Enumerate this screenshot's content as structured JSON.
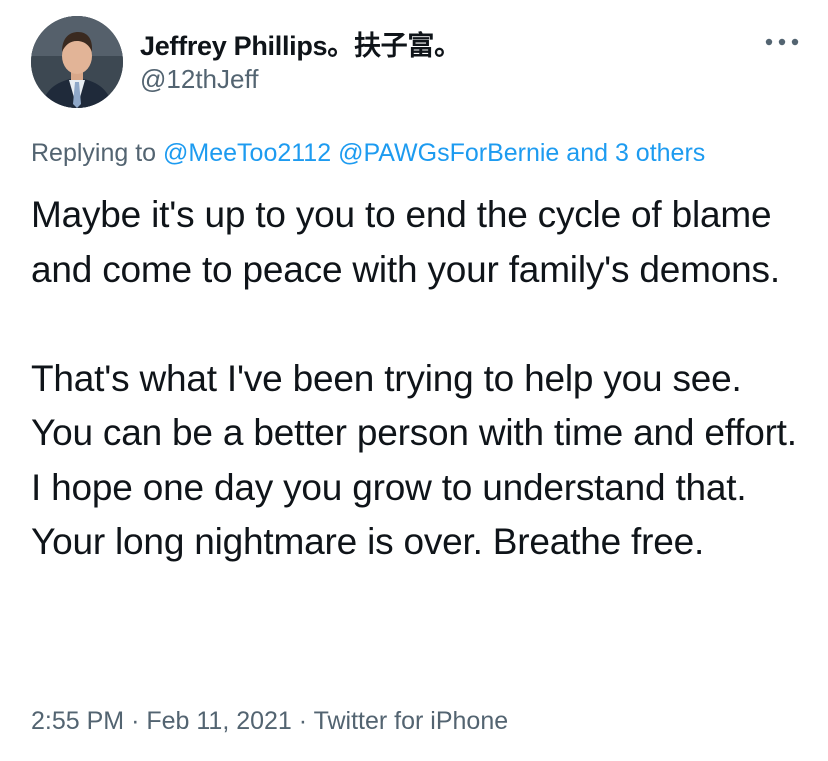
{
  "author": {
    "name": "Jeffrey Phillips。扶子富。",
    "handle": "@12thJeff",
    "avatar_icon": "profile-photo-man-in-suit"
  },
  "more_icon": "more-horizontal-icon",
  "reply": {
    "prefix": "Replying to",
    "mention_1": "@MeeToo2112",
    "mention_2": "@PAWGsForBernie",
    "others": "and 3 others"
  },
  "tweet": {
    "paragraph_1": "Maybe it's up to you to end the cycle of blame and come to peace with your family's demons.",
    "paragraph_2": "That's what I've been trying to help you see. You can be a better person with time and effort. I hope one day you grow to understand that. Your long nightmare is over. Breathe free."
  },
  "meta": {
    "time": "2:55 PM",
    "separator": "·",
    "date": "Feb 11, 2021",
    "source": "Twitter for iPhone"
  },
  "colors": {
    "link": "#1d9bf0",
    "secondary_text": "#536471",
    "primary_text": "#0f1419"
  }
}
